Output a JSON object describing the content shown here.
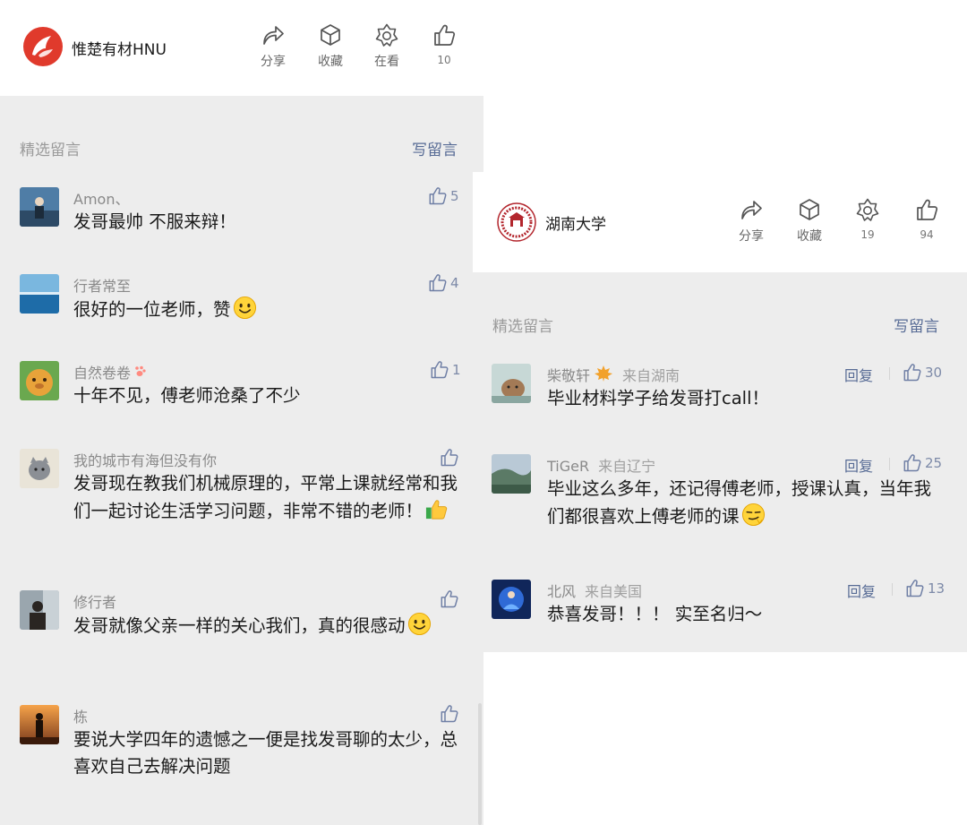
{
  "left": {
    "account": {
      "name": "惟楚有材HNU"
    },
    "actions": [
      {
        "icon": "share-icon",
        "label": "分享"
      },
      {
        "icon": "box-icon",
        "label": "收藏"
      },
      {
        "icon": "star-icon",
        "label": "在看"
      },
      {
        "icon": "thumbs-up-icon",
        "label": "10"
      }
    ],
    "section_title": "精选留言",
    "write_label": "写留言",
    "comments": [
      {
        "name": "Amon、",
        "text": "发哥最帅 不服来辩！",
        "likes": "5"
      },
      {
        "name": "行者常至",
        "text": "很好的一位老师，赞",
        "likes": "4"
      },
      {
        "name": "自然卷卷",
        "text": "十年不见，傅老师沧桑了不少",
        "likes": "1"
      },
      {
        "name": "我的城市有海但没有你",
        "text": "发哥现在教我们机械原理的，平常上课就经常和我们一起讨论生活学习问题，非常不错的老师！",
        "likes": ""
      },
      {
        "name": "修行者",
        "text": "发哥就像父亲一样的关心我们，真的很感动",
        "likes": ""
      },
      {
        "name": "栋",
        "text": "要说大学四年的遗憾之一便是找发哥聊的太少，总喜欢自己去解决问题",
        "likes": ""
      }
    ]
  },
  "right": {
    "account": {
      "name": "湖南大学"
    },
    "actions": [
      {
        "icon": "share-icon",
        "label": "分享"
      },
      {
        "icon": "box-icon",
        "label": "收藏"
      },
      {
        "icon": "star-icon",
        "label": "19"
      },
      {
        "icon": "thumbs-up-icon",
        "label": "94"
      }
    ],
    "section_title": "精选留言",
    "write_label": "写留言",
    "reply_label": "回复",
    "comments": [
      {
        "name": "柴敬轩",
        "location": "来自湖南",
        "text": "毕业材料学子给发哥打call！",
        "likes": "30"
      },
      {
        "name": "TiGeR",
        "location": "来自辽宁",
        "text": "毕业这么多年，还记得傅老师，授课认真，当年我们都很喜欢上傅老师的课",
        "likes": "25"
      },
      {
        "name": "北风",
        "location": "来自美国",
        "text": "恭喜发哥！！！ 实至名归～",
        "likes": "13"
      }
    ]
  },
  "colors": {
    "link": "#576b95",
    "panel_gray": "#ededed",
    "logo_red": "#e03a2c"
  }
}
